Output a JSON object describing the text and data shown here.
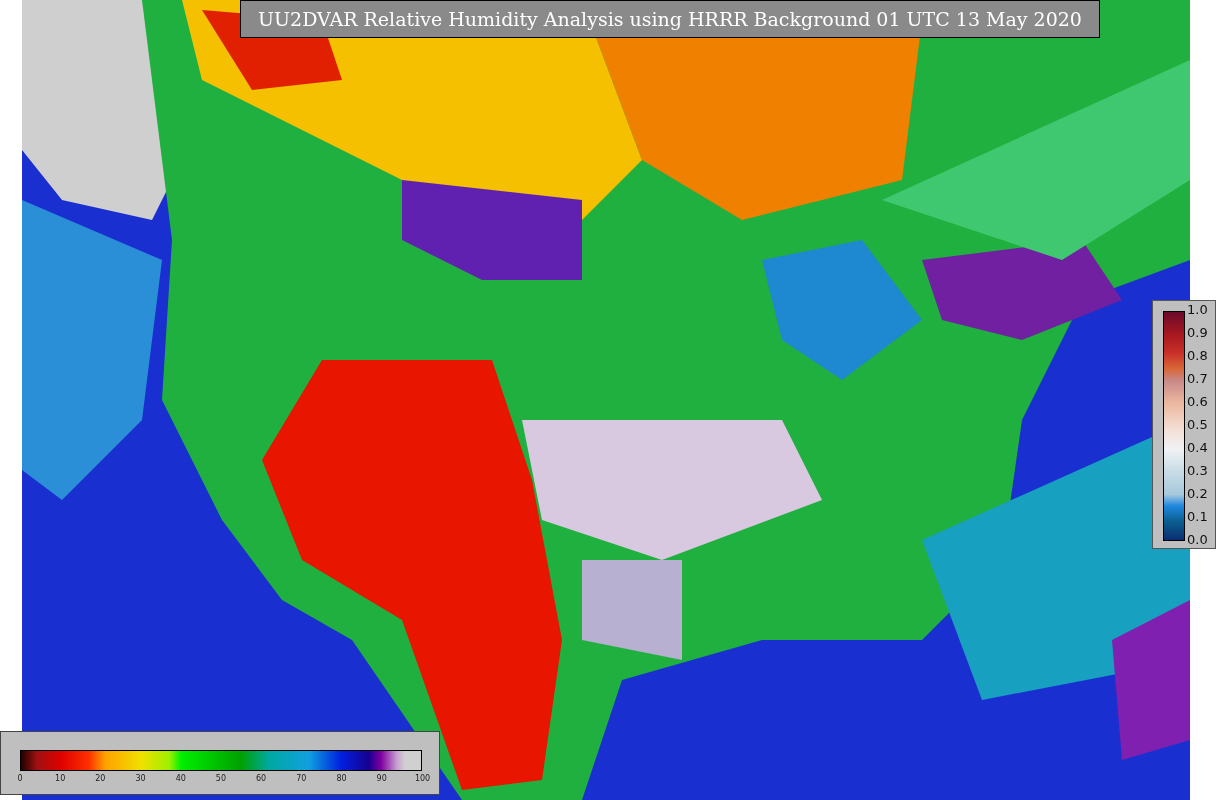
{
  "title": "UU2DVAR Relative Humidity Analysis using HRRR Background 01 UTC 13 May 2020",
  "humidity_scale": {
    "ticks": [
      "0",
      "10",
      "20",
      "30",
      "40",
      "50",
      "60",
      "70",
      "80",
      "90",
      "100"
    ]
  },
  "observation_scale": {
    "ticks": [
      "1.0",
      "0.9",
      "0.8",
      "0.7",
      "0.6",
      "0.5",
      "0.4",
      "0.3",
      "0.2",
      "0.1",
      "0.0"
    ]
  }
}
